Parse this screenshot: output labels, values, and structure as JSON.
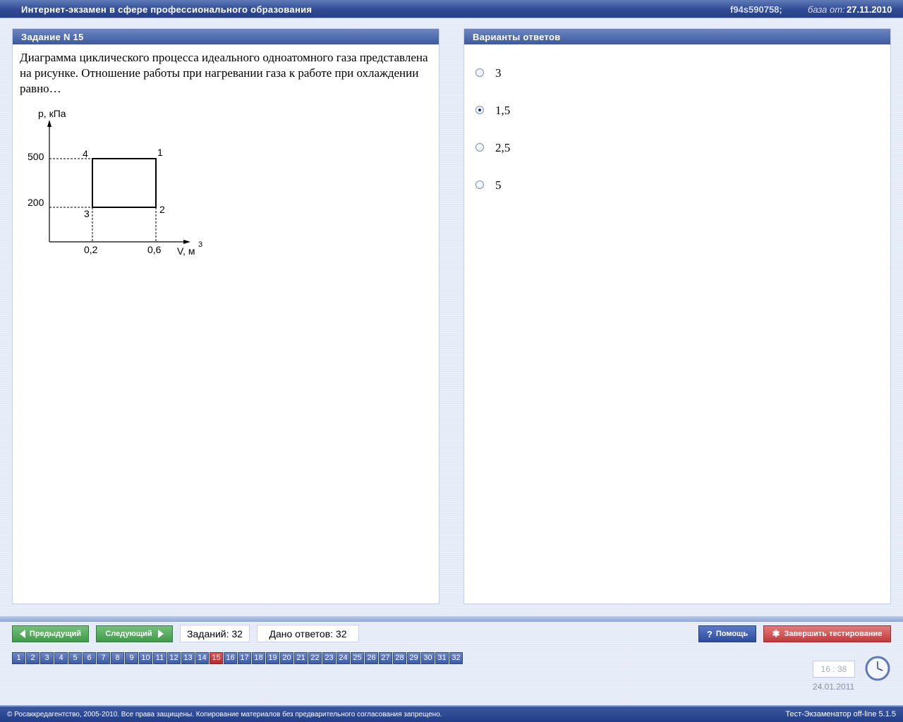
{
  "header": {
    "title": "Интернет-экзамен в сфере профессионального образования",
    "code": "f94s590758;",
    "db_label": "база от:",
    "db_date": "27.11.2010"
  },
  "question": {
    "header": "Задание N 15",
    "text": "Диаграмма циклического процесса идеального одноатомного газа представлена на рисунке. Отношение работы при нагревании газа к работе при охлаждении равно…",
    "figure": {
      "y_label": "p, кПа",
      "x_label": "V, м",
      "x_label_sup": "3",
      "y_ticks": [
        "500",
        "200"
      ],
      "x_ticks": [
        "0,2",
        "0,6"
      ],
      "points": [
        {
          "label": "1",
          "V": 0.6,
          "p": 500
        },
        {
          "label": "2",
          "V": 0.6,
          "p": 200
        },
        {
          "label": "3",
          "V": 0.2,
          "p": 200
        },
        {
          "label": "4",
          "V": 0.2,
          "p": 500
        }
      ]
    }
  },
  "answers": {
    "header": "Варианты ответов",
    "options": [
      {
        "label": "3",
        "selected": false
      },
      {
        "label": "1,5",
        "selected": true
      },
      {
        "label": "2,5",
        "selected": false
      },
      {
        "label": "5",
        "selected": false
      }
    ]
  },
  "nav": {
    "prev_label": "Предыдущий",
    "next_label": "Следующий",
    "tasks_count": "Заданий: 32",
    "answers_count": "Дано ответов: 32",
    "help_label": "Помощь",
    "finish_label": "Завершить тестирование",
    "current_page": 15,
    "pages": [
      "1",
      "2",
      "3",
      "4",
      "5",
      "6",
      "7",
      "8",
      "9",
      "10",
      "11",
      "12",
      "13",
      "14",
      "15",
      "16",
      "17",
      "18",
      "19",
      "20",
      "21",
      "22",
      "23",
      "24",
      "25",
      "26",
      "27",
      "28",
      "29",
      "30",
      "31",
      "32"
    ]
  },
  "clock": {
    "time": "16 : 38",
    "date": "24.01.2011"
  },
  "footer": {
    "copyright": "© Росаккредагентство, 2005-2010. Все права защищены. Копирование материалов без предварительного согласования запрещено.",
    "version": "Тест-Экзаменатор off-line 5.1.5"
  },
  "colors": {
    "header_blue": "#2f4a94",
    "current_page_red": "#c33a3a",
    "next_green": "#3f9a49"
  }
}
